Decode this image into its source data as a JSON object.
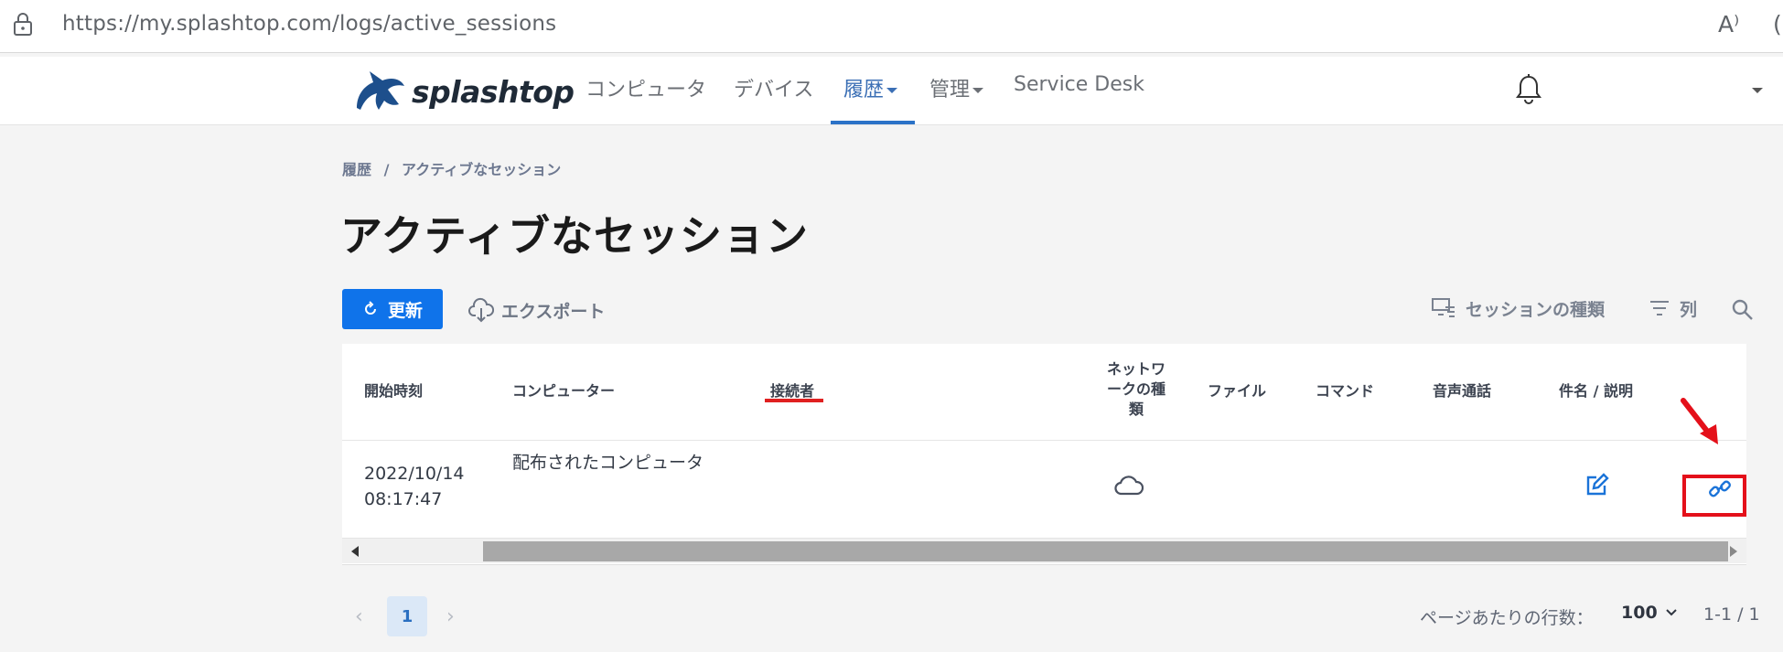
{
  "browser": {
    "url_host": "https://my.splashtop.com",
    "url_path": "/logs/active_sessions",
    "read_aloud_glyph": "A⁾"
  },
  "nav": {
    "brand": "splashtop",
    "items": [
      {
        "label": "コンピュータ"
      },
      {
        "label": "デバイス"
      },
      {
        "label": "履歴",
        "active": true
      },
      {
        "label": "管理"
      },
      {
        "label": "Service Desk"
      }
    ]
  },
  "breadcrumb": {
    "root": "履歴",
    "separator": "/",
    "current": "アクティブなセッション"
  },
  "page": {
    "title": "アクティブなセッション"
  },
  "toolbar": {
    "refresh": "更新",
    "export": "エクスポート",
    "session_type": "セッションの種類",
    "columns": "列"
  },
  "table": {
    "headers": {
      "start_time": "開始時刻",
      "computer": "コンピューター",
      "connector": "接続者",
      "network_type_1": "ネットワ",
      "network_type_2": "ークの種",
      "network_type_3": "類",
      "file": "ファイル",
      "command": "コマンド",
      "voice": "音声通話",
      "subject": "件名 / 説明"
    },
    "rows": [
      {
        "start_date": "2022/10/14",
        "start_time": "08:17:47",
        "computer": "配布されたコンピュータ",
        "connector": "",
        "network_icon": "cloud-icon"
      }
    ]
  },
  "pagination": {
    "prev": "‹",
    "current_page": "1",
    "next": "›",
    "rows_label": "ページあたりの行数：",
    "rows_value": "100",
    "range": "1-1 / 1"
  },
  "colors": {
    "accent": "#0f73ea",
    "annotation": "#e4101a"
  }
}
